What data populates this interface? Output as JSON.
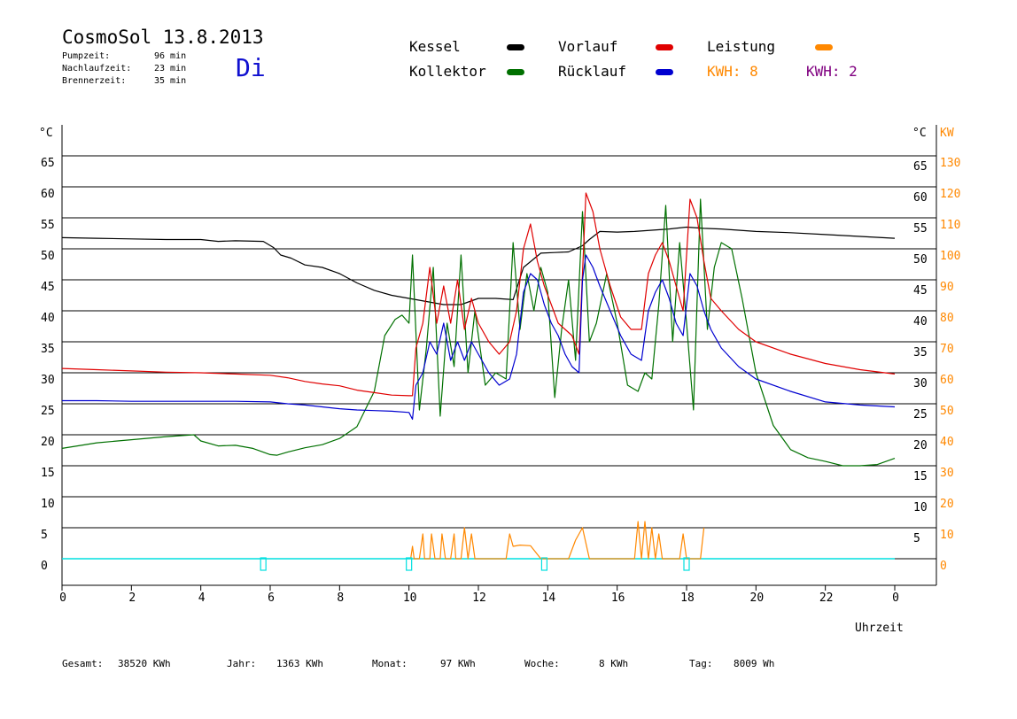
{
  "header": {
    "title": "CosmoSol 13.8.2013",
    "day": "Di",
    "stats": [
      {
        "label": "Pumpzeit:",
        "value": "96 min"
      },
      {
        "label": "Nachlaufzeit:",
        "value": "23 min"
      },
      {
        "label": "Brennerzeit:",
        "value": "35 min"
      }
    ]
  },
  "legend": {
    "kessel": "Kessel",
    "kollektor": "Kollektor",
    "vorlauf": "Vorlauf",
    "ruecklauf": "Rücklauf",
    "leistung": "Leistung",
    "kwh1": "KWH: 8",
    "kwh2": "KWH: 2"
  },
  "footer": [
    {
      "label": "Gesamt:",
      "value": "38520 KWh"
    },
    {
      "label": "Jahr:",
      "value": "1363 KWh"
    },
    {
      "label": "Monat:",
      "value": "97 KWh"
    },
    {
      "label": "Woche:",
      "value": "8 KWh"
    },
    {
      "label": "Tag:",
      "value": "8009 Wh"
    }
  ],
  "chart_data": {
    "type": "line",
    "xlabel": "Uhrzeit",
    "ylabel_left": "°C",
    "ylabel_right_1": "°C",
    "ylabel_right_2": "KW",
    "xlim": [
      0,
      24
    ],
    "ylim": [
      0,
      70
    ],
    "x_ticks": [
      "0",
      "2",
      "4",
      "6",
      "8",
      "10",
      "12",
      "14",
      "16",
      "18",
      "20",
      "22",
      "0"
    ],
    "y_ticks_left": [
      "0",
      "5",
      "10",
      "15",
      "20",
      "25",
      "30",
      "35",
      "40",
      "45",
      "50",
      "55",
      "60",
      "65"
    ],
    "y_ticks_right": [
      "5",
      "10",
      "15",
      "20",
      "25",
      "30",
      "35",
      "40",
      "45",
      "50",
      "55",
      "60",
      "65"
    ],
    "y_ticks_kw": [
      "0",
      "10",
      "20",
      "30",
      "40",
      "50",
      "60",
      "70",
      "80",
      "90",
      "100",
      "110",
      "120",
      "130"
    ],
    "grid": true,
    "colors": {
      "kessel": "#000000",
      "kollektor": "#007000",
      "vorlauf": "#e00000",
      "ruecklauf": "#0000d0",
      "leistung": "#ff8800",
      "kwh2": "#800080",
      "pump": "#00e0e0"
    },
    "series": [
      {
        "name": "Kessel",
        "key": "kessel",
        "x": [
          0,
          1,
          2,
          3,
          4,
          4.5,
          5,
          5.8,
          6.1,
          6.3,
          6.6,
          7,
          7.5,
          8,
          8.5,
          9,
          9.5,
          10,
          10.5,
          11,
          11.5,
          12,
          12.5,
          13,
          13.3,
          13.8,
          14.2,
          14.6,
          15,
          15.2,
          15.5,
          16,
          16.5,
          17,
          17.5,
          18,
          18.5,
          19,
          19.5,
          20,
          21,
          22,
          23,
          24
        ],
        "y": [
          51.8,
          51.7,
          51.6,
          51.5,
          51.5,
          51.2,
          51.3,
          51.2,
          50.2,
          49,
          48.5,
          47.4,
          47,
          46,
          44.5,
          43.3,
          42.5,
          42,
          41.5,
          41,
          41,
          42,
          42,
          41.8,
          47,
          49.3,
          49.4,
          49.5,
          50.5,
          51.5,
          52.8,
          52.7,
          52.8,
          53,
          53.2,
          53.5,
          53.3,
          53.2,
          53,
          52.8,
          52.6,
          52.3,
          52,
          51.7
        ]
      },
      {
        "name": "Kollektor",
        "key": "kollektor",
        "x": [
          0,
          1,
          2,
          3,
          3.8,
          4,
          4.5,
          5,
          5.5,
          6,
          6.2,
          6.5,
          7,
          7.5,
          8,
          8.5,
          9,
          9.3,
          9.6,
          9.8,
          10,
          10.1,
          10.3,
          10.5,
          10.7,
          10.9,
          11.1,
          11.3,
          11.5,
          11.7,
          11.9,
          12.2,
          12.5,
          12.8,
          13,
          13.2,
          13.4,
          13.6,
          13.8,
          14,
          14.2,
          14.4,
          14.6,
          14.8,
          15,
          15.2,
          15.4,
          15.7,
          16,
          16.3,
          16.6,
          16.8,
          17,
          17.2,
          17.4,
          17.6,
          17.8,
          18,
          18.2,
          18.4,
          18.6,
          18.8,
          19,
          19.3,
          19.6,
          20,
          20.5,
          21,
          21.5,
          22,
          22.5,
          23,
          23.5,
          24
        ],
        "y": [
          17.8,
          18.7,
          19.2,
          19.7,
          20,
          19,
          18.2,
          18.3,
          17.8,
          16.8,
          16.7,
          17.2,
          17.9,
          18.4,
          19.4,
          21.3,
          27,
          36,
          38.6,
          39.3,
          38,
          49,
          24,
          34,
          47,
          23,
          38,
          31,
          49,
          30,
          40,
          28,
          30,
          29,
          51,
          37,
          46,
          40,
          47,
          43,
          26,
          37,
          45,
          32,
          56,
          35,
          38,
          46,
          38,
          28,
          27,
          30,
          29,
          41,
          57,
          35,
          51,
          38,
          24,
          58,
          37,
          47,
          51,
          50,
          42,
          30,
          21.5,
          17.6,
          16.3,
          15.7,
          15,
          15,
          15.2,
          16.2
        ]
      },
      {
        "name": "Vorlauf",
        "key": "vorlauf",
        "x": [
          0,
          1,
          2,
          3,
          4,
          5,
          6,
          6.5,
          7,
          7.5,
          8,
          8.5,
          9,
          9.5,
          10,
          10.1,
          10.2,
          10.4,
          10.6,
          10.8,
          11,
          11.2,
          11.4,
          11.6,
          11.8,
          12,
          12.3,
          12.6,
          12.9,
          13.1,
          13.3,
          13.5,
          13.7,
          13.9,
          14.1,
          14.3,
          14.5,
          14.7,
          14.9,
          15,
          15.1,
          15.3,
          15.5,
          15.8,
          16.1,
          16.4,
          16.7,
          16.9,
          17.1,
          17.3,
          17.5,
          17.7,
          17.9,
          18.1,
          18.3,
          18.5,
          18.7,
          19,
          19.5,
          20,
          21,
          22,
          23,
          24
        ],
        "y": [
          30.7,
          30.5,
          30.3,
          30.1,
          30,
          29.8,
          29.6,
          29.2,
          28.6,
          28.2,
          27.9,
          27.2,
          26.8,
          26.4,
          26.3,
          26.3,
          34,
          38,
          47,
          38,
          44,
          38,
          45,
          37,
          42,
          38,
          35,
          33,
          35,
          40,
          50,
          54,
          48,
          44,
          41,
          38,
          37,
          36,
          33,
          46,
          59,
          56,
          50,
          44,
          39,
          37,
          37,
          46,
          49,
          51,
          48,
          44,
          40,
          58,
          55,
          48,
          42,
          40,
          37,
          35,
          33,
          31.5,
          30.5,
          29.8
        ]
      },
      {
        "name": "Rücklauf",
        "key": "ruecklauf",
        "x": [
          0,
          1,
          2,
          3,
          4,
          5,
          6,
          6.5,
          7,
          7.5,
          8,
          8.5,
          9,
          9.5,
          10,
          10.1,
          10.2,
          10.4,
          10.6,
          10.8,
          11,
          11.2,
          11.4,
          11.6,
          11.8,
          12,
          12.3,
          12.6,
          12.9,
          13.1,
          13.3,
          13.5,
          13.7,
          13.9,
          14.1,
          14.3,
          14.5,
          14.7,
          14.9,
          15,
          15.1,
          15.3,
          15.5,
          15.8,
          16.1,
          16.4,
          16.7,
          16.9,
          17.1,
          17.3,
          17.5,
          17.7,
          17.9,
          18.1,
          18.3,
          18.5,
          18.7,
          19,
          19.5,
          20,
          21,
          22,
          23,
          24
        ],
        "y": [
          25.5,
          25.5,
          25.4,
          25.4,
          25.4,
          25.4,
          25.3,
          25,
          24.8,
          24.5,
          24.2,
          24,
          23.9,
          23.8,
          23.6,
          22.5,
          28,
          30,
          35,
          33,
          38,
          32,
          35,
          32,
          35,
          33,
          30,
          28,
          29,
          33,
          43,
          46,
          45,
          41,
          38,
          36,
          33,
          31,
          30,
          45,
          49,
          47,
          44,
          40,
          36,
          33,
          32,
          40,
          43,
          45,
          42,
          38,
          36,
          46,
          44,
          40,
          37,
          34,
          31,
          29,
          27,
          25.3,
          24.8,
          24.5
        ]
      },
      {
        "name": "Leistung",
        "key": "leistung",
        "x": [
          10.05,
          10.1,
          10.15,
          10.3,
          10.4,
          10.45,
          10.6,
          10.65,
          10.75,
          10.9,
          10.95,
          11.05,
          11.2,
          11.3,
          11.35,
          11.5,
          11.6,
          11.7,
          11.8,
          11.9,
          12.8,
          12.9,
          13,
          13.2,
          13.5,
          13.8,
          14.6,
          14.8,
          15,
          15.2,
          16.5,
          16.6,
          16.7,
          16.8,
          16.9,
          17,
          17.1,
          17.2,
          17.3,
          17.4,
          17.8,
          17.9,
          18,
          18.4,
          18.5
        ],
        "y": [
          0,
          2,
          0,
          0,
          4,
          0,
          0,
          4,
          0,
          0,
          4,
          0,
          0,
          4,
          0,
          0,
          5,
          0,
          4,
          0,
          0,
          4,
          2,
          2.2,
          2.1,
          0,
          0,
          3,
          5,
          0,
          0,
          6,
          0,
          6,
          0,
          5,
          0,
          4,
          0,
          0,
          0,
          4,
          0,
          0,
          5
        ]
      }
    ],
    "pump_markers_x": [
      5.8,
      10,
      13.9,
      18
    ]
  }
}
